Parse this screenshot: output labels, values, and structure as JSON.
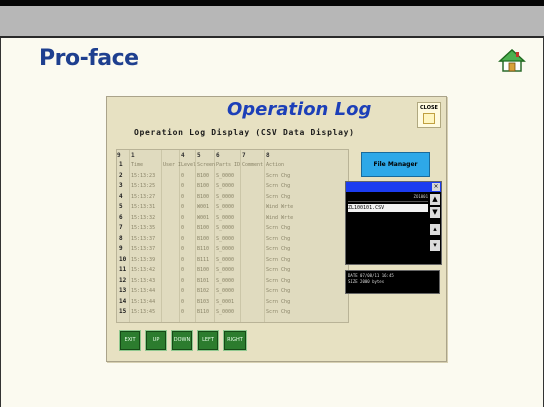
{
  "brand": {
    "name": "Pro-face"
  },
  "icons": {
    "home": "home-icon",
    "close": "close-icon",
    "scroll_up": "chevron-up-icon",
    "scroll_down": "chevron-down-icon"
  },
  "colors": {
    "brand": "#1e3f8f",
    "title": "#1c3fb8",
    "panel": "#e7e1c2",
    "file_manager": "#2ea8e8",
    "list_titlebar": "#1c3cf0",
    "buttons": "#2c7c2e"
  },
  "operation_log": {
    "title": "Operation Log",
    "close_label": "CLOSE",
    "subtitle": "Operation Log Display (CSV Data Display)",
    "table": {
      "column_numbers": [
        "1",
        "4",
        "5",
        "6",
        "7",
        "8",
        "9"
      ],
      "column_headers": [
        "Time",
        "User ID",
        "Level",
        "Screen",
        "Parts ID",
        "Comment",
        "Action"
      ],
      "rows": [
        {
          "n": "1",
          "cells": [
            "Time",
            "User ID",
            "Level",
            "Screen",
            "Parts ID",
            "Comment",
            "Action"
          ]
        },
        {
          "n": "2",
          "cells": [
            "15:13:23",
            "",
            "0",
            "B100",
            "S_0000",
            "",
            "Scrn Chg"
          ]
        },
        {
          "n": "3",
          "cells": [
            "15:13:25",
            "",
            "0",
            "B100",
            "S_0000",
            "",
            "Scrn Chg"
          ]
        },
        {
          "n": "4",
          "cells": [
            "15:13:27",
            "",
            "0",
            "B100",
            "S_0000",
            "",
            "Scrn Chg"
          ]
        },
        {
          "n": "5",
          "cells": [
            "15:13:31",
            "",
            "0",
            "W001",
            "S_0000",
            "",
            "Wind Wrte"
          ]
        },
        {
          "n": "6",
          "cells": [
            "15:13:32",
            "",
            "0",
            "W001",
            "S_0000",
            "",
            "Wind Wrte"
          ]
        },
        {
          "n": "7",
          "cells": [
            "15:13:35",
            "",
            "0",
            "B100",
            "S_0000",
            "",
            "Scrn Chg"
          ]
        },
        {
          "n": "8",
          "cells": [
            "15:13:37",
            "",
            "0",
            "B100",
            "S_0000",
            "",
            "Scrn Chg"
          ]
        },
        {
          "n": "9",
          "cells": [
            "15:13:37",
            "",
            "0",
            "B110",
            "S_0000",
            "",
            "Scrn Chg"
          ]
        },
        {
          "n": "10",
          "cells": [
            "15:13:39",
            "",
            "0",
            "B111",
            "S_0000",
            "",
            "Scrn Chg"
          ]
        },
        {
          "n": "11",
          "cells": [
            "15:13:42",
            "",
            "0",
            "B100",
            "S_0000",
            "",
            "Scrn Chg"
          ]
        },
        {
          "n": "12",
          "cells": [
            "15:13:43",
            "",
            "0",
            "B101",
            "S_0000",
            "",
            "Scrn Chg"
          ]
        },
        {
          "n": "13",
          "cells": [
            "15:13:44",
            "",
            "0",
            "B102",
            "S_0000",
            "",
            "Scrn Chg"
          ]
        },
        {
          "n": "14",
          "cells": [
            "15:13:44",
            "",
            "0",
            "B103",
            "S_0001",
            "",
            "Scrn Chg"
          ]
        },
        {
          "n": "15",
          "cells": [
            "15:13:45",
            "",
            "0",
            "B110",
            "S_0000",
            "",
            "Scrn Chg"
          ]
        }
      ]
    },
    "file_manager_label": "File Manager",
    "file_list": {
      "path_text": "ZO1001",
      "selected_file": "ZL100101.CSV"
    },
    "info_text": "DATE 07/08/11 16:45\nSIZE 2000 bytes",
    "buttons": [
      "EXIT",
      "UP",
      "DOWN",
      "LEFT",
      "RIGHT"
    ]
  }
}
